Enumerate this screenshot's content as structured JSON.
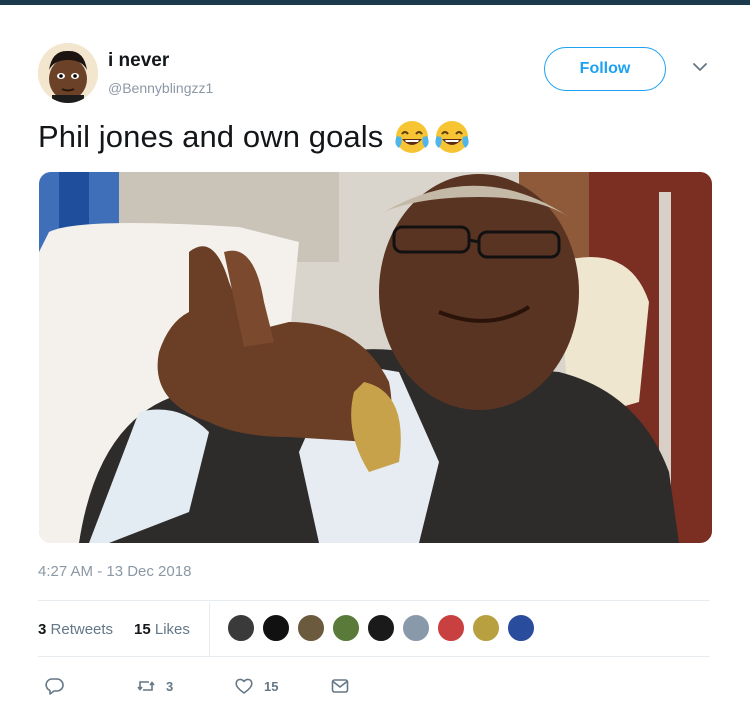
{
  "tweet": {
    "author_name": "i never",
    "author_handle": "@Bennyblingzz1",
    "follow_label": "Follow",
    "text": "Phil jones and own goals",
    "emojis": [
      "face-with-tears-of-joy",
      "face-with-tears-of-joy"
    ],
    "timestamp": "4:27 AM - 13 Dec 2018",
    "retweets_count": "3",
    "retweets_label": "Retweets",
    "likes_count": "15",
    "likes_label": "Likes",
    "liker_avatar_colors": [
      "#3a3a3a",
      "#111111",
      "#6b5a3e",
      "#5a7a3a",
      "#1a1a1a",
      "#8899aa",
      "#c94040",
      "#b8a040",
      "#2a4c9c"
    ],
    "actions": {
      "reply_icon": "reply-icon",
      "retweet_count": "3",
      "like_count": "15",
      "message_icon": "direct-message-icon"
    }
  },
  "colors": {
    "accent": "#1da1f2",
    "topbar": "#1b3a4b",
    "muted": "#657786"
  }
}
